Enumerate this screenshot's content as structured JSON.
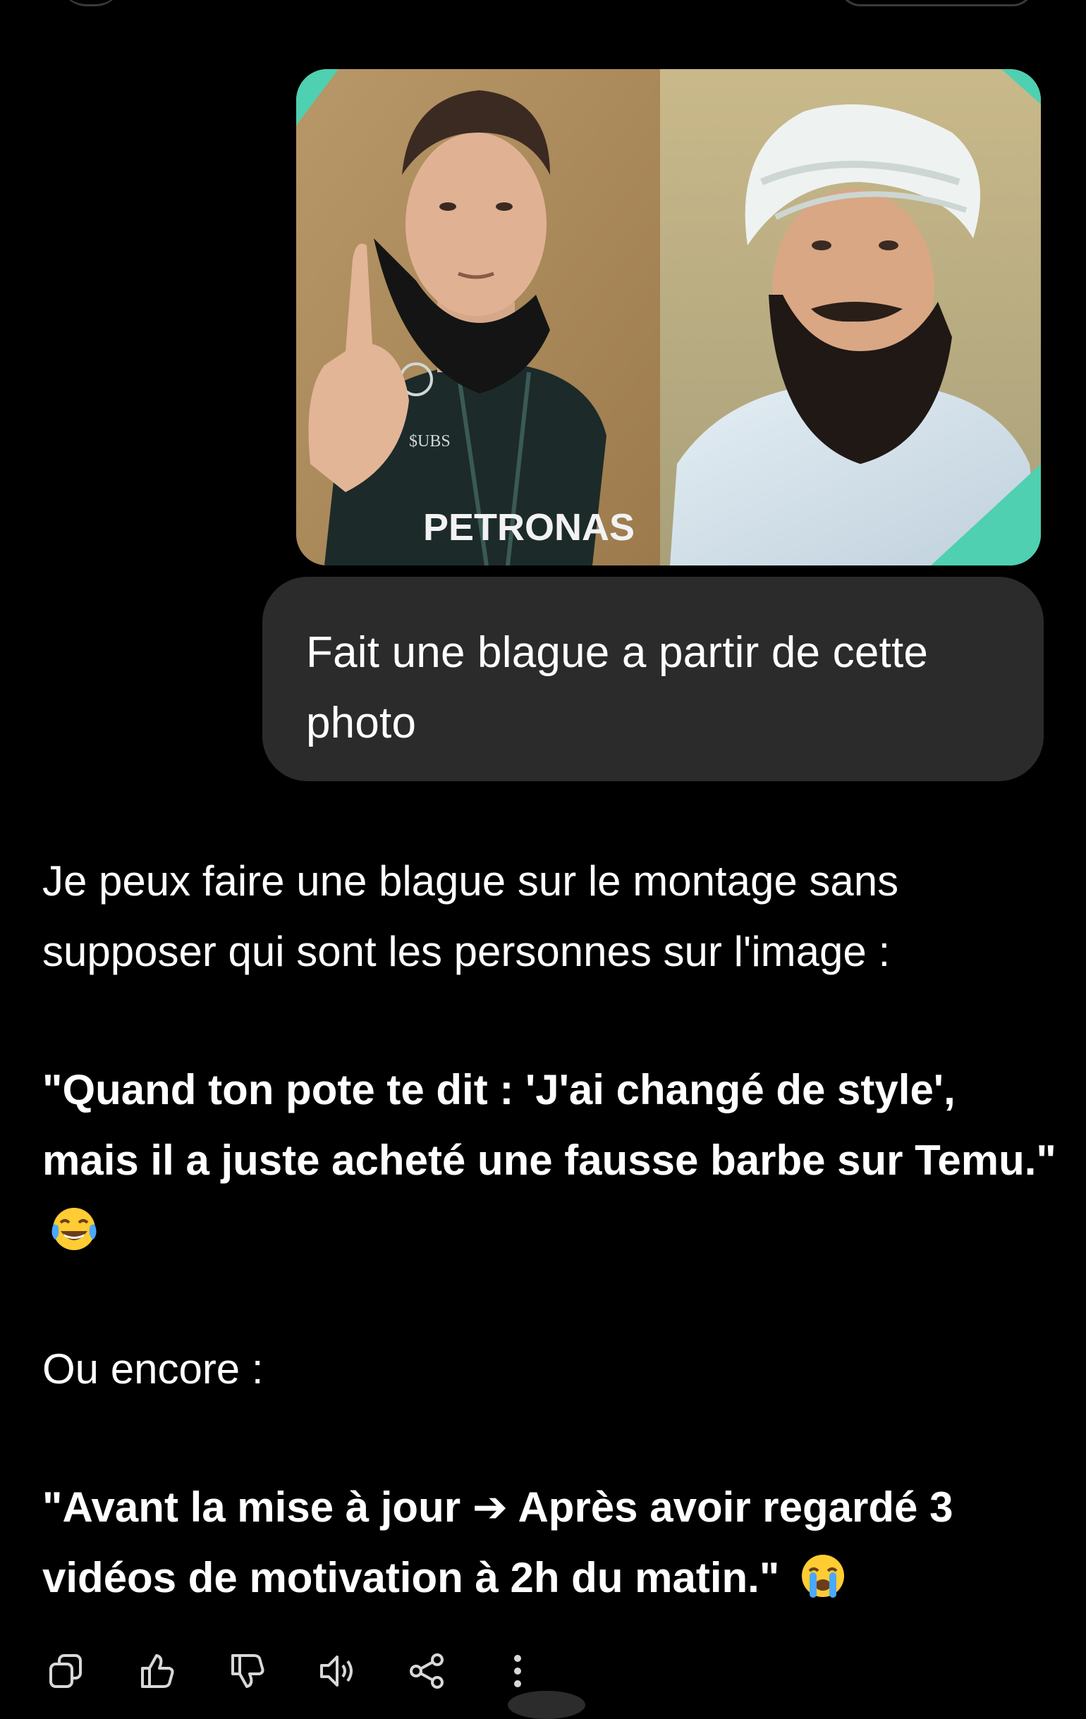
{
  "user_message": {
    "text": "Fait une blague a partir de cette photo",
    "image_overlay_text": "PETRONAS"
  },
  "assistant_message": {
    "intro": "Je peux faire une blague sur le montage sans supposer qui sont les personnes sur l'image :",
    "joke_1": "\"Quand ton pote te dit : 'J'ai changé de style', mais il a juste acheté une fausse barbe sur Temu.\"",
    "joke_1_emoji": "face-with-tears-of-joy",
    "transition": "Ou encore :",
    "joke_2": "\"Avant la mise à jour ➔ Après avoir regardé 3 vidéos de motivation à 2h du matin.\"",
    "joke_2_emoji": "loudly-crying-face"
  },
  "actions": {
    "icons": [
      "copy-icon",
      "thumbs-up-icon",
      "thumbs-down-icon",
      "read-aloud-icon",
      "share-icon",
      "more-icon"
    ]
  },
  "colors": {
    "background": "#000000",
    "bubble": "#2b2b2b",
    "text": "#ffffff",
    "icon": "#d8d8d8"
  }
}
